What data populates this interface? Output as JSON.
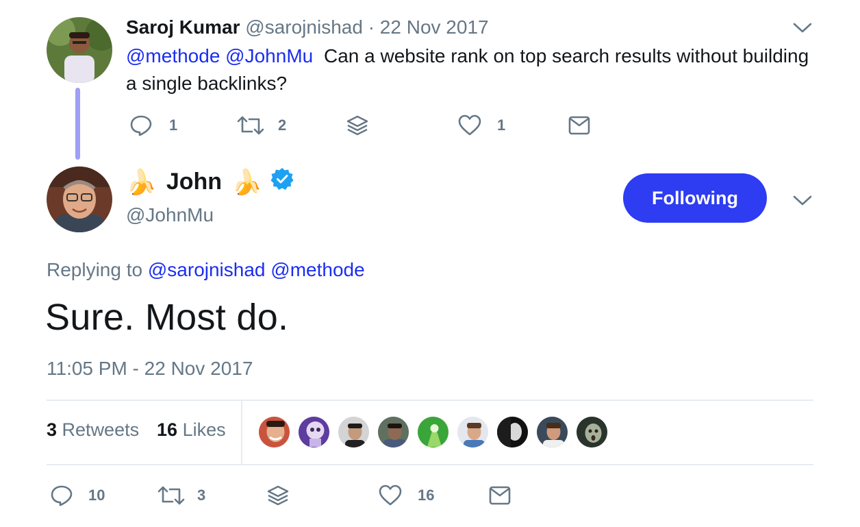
{
  "parent_tweet": {
    "author_name": "Saroj Kumar",
    "author_handle": "@sarojnishad",
    "separator": "·",
    "date": "22 Nov 2017",
    "mention_1": "@methode",
    "mention_2": "@JohnMu",
    "text": "Can a website rank on top search results without building a single backlinks?",
    "reply_count": "1",
    "retweet_count": "2",
    "like_count": "1"
  },
  "main_tweet": {
    "emoji_left": "🍌",
    "author_name": "John",
    "emoji_right": "🍌",
    "author_handle": "@JohnMu",
    "follow_label": "Following",
    "replying_prefix": "Replying to",
    "replying_mentions": "@sarojnishad @methode",
    "text": "Sure. Most do.",
    "timestamp": "11:05 PM - 22 Nov 2017",
    "retweets_count": "3",
    "retweets_label": "Retweets",
    "likes_count": "16",
    "likes_label": "Likes",
    "reply_count": "10",
    "retweet_count": "3",
    "like_count": "16"
  },
  "colors": {
    "accent": "#2e3cf2",
    "mention": "#1b2df0",
    "secondary_text": "#657786",
    "thread_line": "#9e9ff5",
    "verified": "#1da1f2"
  },
  "icons": [
    "reply-icon",
    "retweet-icon",
    "stack-icon",
    "heart-icon",
    "mail-icon",
    "chevron-down-icon",
    "verified-badge-icon"
  ]
}
